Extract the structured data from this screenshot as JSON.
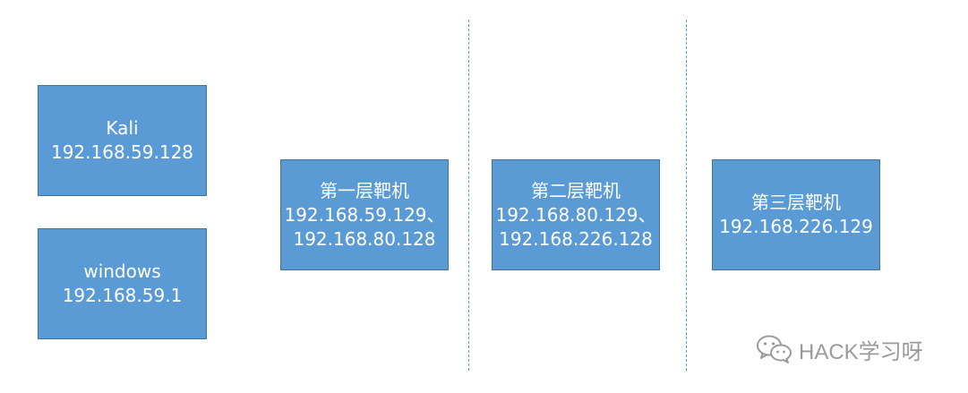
{
  "nodes": {
    "kali": {
      "line1": "Kali",
      "line2": "192.168.59.128"
    },
    "windows": {
      "line1": "windows",
      "line2": "192.168.59.1"
    },
    "layer1": {
      "line1": "第一层靶机",
      "line2": "192.168.59.129、",
      "line3": "192.168.80.128"
    },
    "layer2": {
      "line1": "第二层靶机",
      "line2": "192.168.80.129、",
      "line3": "192.168.226.128"
    },
    "layer3": {
      "line1": "第三层靶机",
      "line2": "192.168.226.129"
    }
  },
  "watermark": {
    "text": "HACK学习呀",
    "icon": "wechat-icon"
  },
  "colors": {
    "box_fill": "#5b9bd5",
    "box_border": "#41719c",
    "divider": "#5b9bd5",
    "watermark": "#9a9a9a"
  }
}
